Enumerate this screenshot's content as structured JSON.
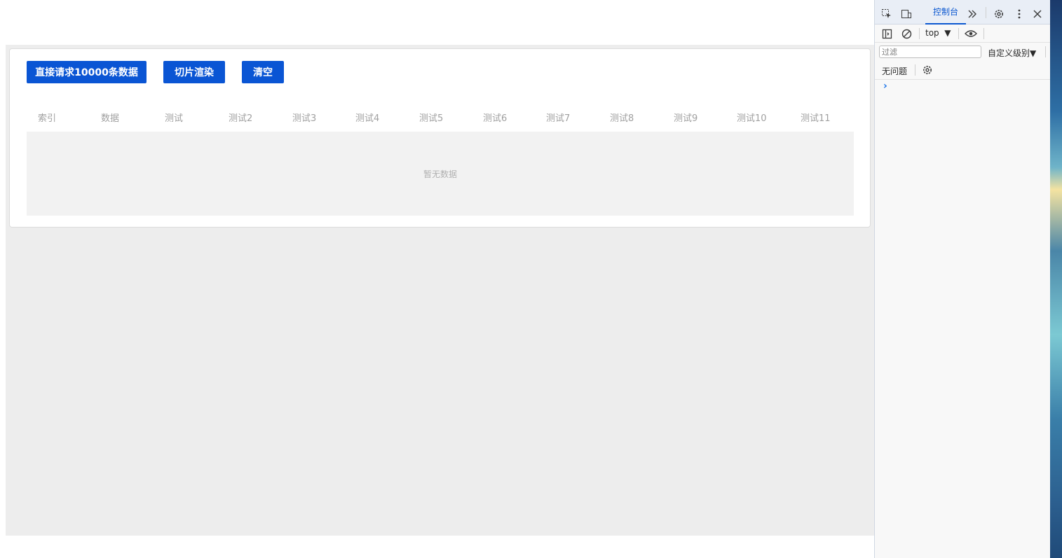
{
  "app": {
    "buttons": {
      "request": "直接请求10000条数据",
      "slice": "切片渲染",
      "clear": "清空"
    },
    "table": {
      "columns": [
        "索引",
        "数据",
        "测试",
        "测试2",
        "测试3",
        "测试4",
        "测试5",
        "测试6",
        "测试7",
        "测试8",
        "测试9",
        "测试10",
        "测试11"
      ],
      "empty_text": "暂无数据"
    }
  },
  "devtools": {
    "tab_console": "控制台",
    "context": "top",
    "filter_placeholder": "过滤",
    "level": "自定义级别",
    "issues": "无问题",
    "prompt": "›"
  },
  "colors": {
    "accent": "#0a55d4",
    "devtools_active": "#0b57d0"
  }
}
